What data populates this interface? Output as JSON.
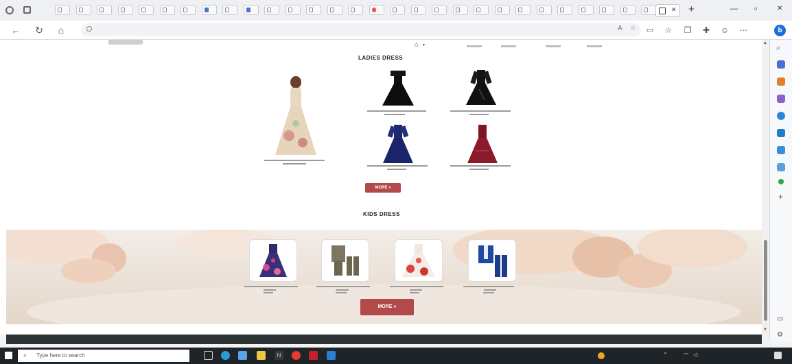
{
  "browser": {
    "url": "",
    "tab_title": "",
    "new_tab_label": "+",
    "window_minimize": "—",
    "window_maximize": "▫",
    "window_close": "✕"
  },
  "site": {
    "logo": "",
    "nav_links": [
      "",
      "",
      "",
      ""
    ]
  },
  "ladies_section": {
    "title": "LADIES DRESS",
    "products": [
      {
        "label": "",
        "price": ""
      },
      {
        "label": "",
        "price": ""
      },
      {
        "label": "",
        "price": ""
      },
      {
        "label": "",
        "price": ""
      },
      {
        "label": "",
        "price": ""
      }
    ],
    "more_button": "MORE »"
  },
  "kids_section": {
    "title": "KIDS DRESS",
    "products": [
      {
        "label": "",
        "price": ""
      },
      {
        "label": "",
        "price": ""
      },
      {
        "label": "",
        "price": ""
      },
      {
        "label": "",
        "price": ""
      }
    ],
    "more_button": "MORE »"
  },
  "taskbar": {
    "search_placeholder": "Type here to search",
    "weather": "",
    "clock_time": "",
    "clock_date": ""
  },
  "colors": {
    "accent_button": "#b24a4a",
    "taskbar_bg": "#1f2428",
    "footer_strip": "#2d3436"
  },
  "icons": [
    "tab-favicon",
    "back-arrow-icon",
    "refresh-icon",
    "home-icon",
    "lock-icon",
    "star-icon",
    "collections-icon",
    "profile-icon",
    "menu-dots-icon",
    "bing-icon",
    "search-icon",
    "windows-start-icon",
    "task-view-icon",
    "edge-icon",
    "file-explorer-icon",
    "vscode-icon",
    "wifi-icon",
    "volume-icon",
    "notification-icon"
  ]
}
